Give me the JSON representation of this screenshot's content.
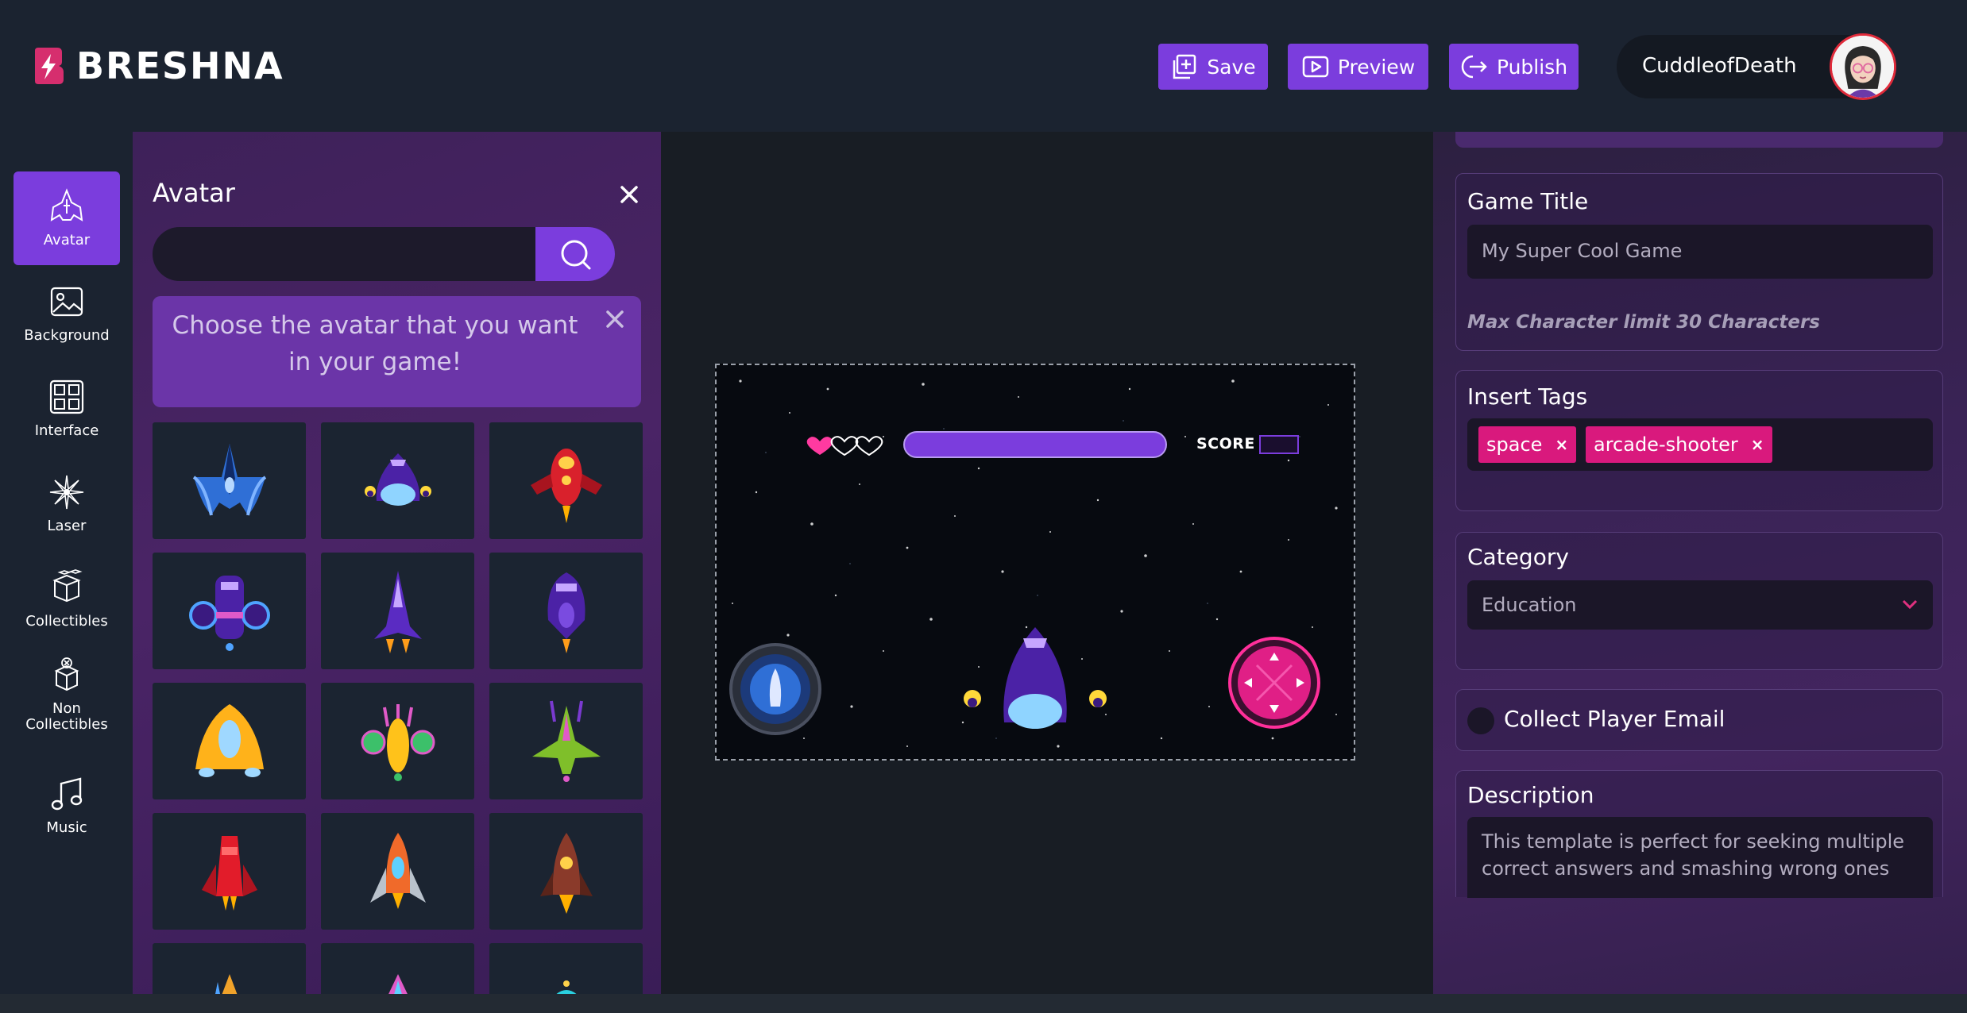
{
  "brand": {
    "name": "BRESHNA"
  },
  "header": {
    "save_label": "Save",
    "preview_label": "Preview",
    "publish_label": "Publish",
    "username": "CuddleofDeath"
  },
  "sidebar": {
    "items": [
      {
        "label": "Avatar",
        "icon": "spaceship-icon",
        "active": true
      },
      {
        "label": "Background",
        "icon": "image-icon"
      },
      {
        "label": "Interface",
        "icon": "layout-icon"
      },
      {
        "label": "Laser",
        "icon": "burst-icon"
      },
      {
        "label": "Collectibles",
        "icon": "boxes-icon"
      },
      {
        "label": "Non\nCollectibles",
        "icon": "crossed-box-icon"
      },
      {
        "label": "Music",
        "icon": "music-note-icon"
      }
    ]
  },
  "panel": {
    "title": "Avatar",
    "search_value": "",
    "hint": "Choose the avatar that you want in your game!",
    "avatars": [
      "blue-winged-ship",
      "purple-saucer-ship",
      "red-rocket-ship",
      "purple-twin-engine-ship",
      "purple-dart-ship",
      "purple-pod-ship",
      "orange-lander-ship",
      "yellow-green-bug-ship",
      "green-fighter-ship",
      "red-cylinder-ship",
      "orange-silver-rocket",
      "brown-rocket",
      "partial-ship-1",
      "partial-ship-2",
      "partial-ship-3"
    ]
  },
  "game_preview": {
    "lives_full": 1,
    "lives_total": 3,
    "score_label": "SCORE"
  },
  "settings": {
    "game_title": {
      "label": "Game Title",
      "value": "My Super Cool Game",
      "note": "Max Character limit 30 Characters"
    },
    "tags": {
      "label": "Insert Tags",
      "items": [
        "space",
        "arcade-shooter"
      ]
    },
    "category": {
      "label": "Category",
      "value": "Education"
    },
    "collect_email": {
      "label": "Collect Player Email",
      "enabled": false
    },
    "description": {
      "label": "Description",
      "value": "This template is perfect for seeking multiple correct answers and smashing wrong ones"
    }
  },
  "colors": {
    "accent": "#7b3ddd",
    "tag": "#d9197d",
    "panel": "#3e2159",
    "header": "#1b2330"
  }
}
